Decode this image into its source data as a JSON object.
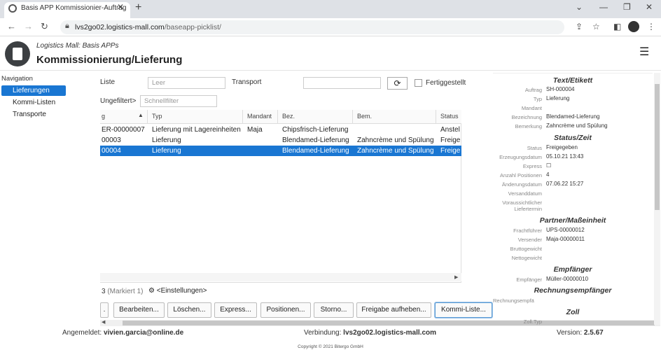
{
  "browser": {
    "tab_title": "Basis APP Kommissionier-Auftrag",
    "url_host": "lvs2go02.logistics-mall.com",
    "url_path": "/baseapp-picklist/"
  },
  "app": {
    "subtitle": "Logistics Mall: Basis APPs",
    "title": "Kommissionierung/Lieferung"
  },
  "nav": {
    "heading": "Navigation",
    "items": [
      {
        "label": "Lieferungen",
        "active": true
      },
      {
        "label": "Kommi-Listen",
        "active": false
      },
      {
        "label": "Transporte",
        "active": false
      }
    ]
  },
  "filters": {
    "liste_label": "Liste",
    "liste_placeholder": "Leer",
    "transport_label": "Transport",
    "fertig_label": "Fertiggestellt",
    "filter_label": "Ungefiltert>",
    "quick_placeholder": "Schnellfilter"
  },
  "table": {
    "headers": [
      "g",
      "Typ",
      "Mandant",
      "Bez.",
      "Bem.",
      "Status"
    ],
    "rows": [
      {
        "id": "ER-00000007",
        "typ": "Lieferung mit Lagereinheiten",
        "mandant": "Maja",
        "bez": "Chipsfrisch-Lieferung",
        "bem": "",
        "status": "Anstel",
        "selected": false
      },
      {
        "id": "00003",
        "typ": "Lieferung",
        "mandant": "",
        "bez": "Blendamed-Lieferung",
        "bem": "Zahncrème und Spülung",
        "status": "Freige",
        "selected": false
      },
      {
        "id": "00004",
        "typ": "Lieferung",
        "mandant": "",
        "bez": "Blendamed-Lieferung",
        "bem": "Zahncrème und Spülung",
        "status": "Freige",
        "selected": true
      }
    ],
    "count": "3",
    "marked": "(Markiert 1)",
    "settings": "<Einstellungen>"
  },
  "buttons": [
    "Bearbeiten...",
    "Löschen...",
    "Express...",
    "Positionen...",
    "Storno...",
    "Freigabe aufheben...",
    "Kommi-Liste..."
  ],
  "panel": {
    "text_title": "Text/Etikett",
    "text_fields": [
      {
        "k": "Auftrag",
        "v": "SH-000004"
      },
      {
        "k": "Typ",
        "v": "Lieferung"
      },
      {
        "k": "Mandant",
        "v": ""
      },
      {
        "k": "Bezeichnung",
        "v": "Blendamed-Lieferung"
      },
      {
        "k": "Bemerkung",
        "v": "Zahncrème und Spülung"
      }
    ],
    "status_title": "Status/Zeit",
    "status_fields": [
      {
        "k": "Status",
        "v": "Freigegeben"
      },
      {
        "k": "Erzeugungsdatum",
        "v": "05.10.21 13:43"
      },
      {
        "k": "Express",
        "v": "☐"
      },
      {
        "k": "Anzahl Positionen",
        "v": "4"
      },
      {
        "k": "Änderungsdatum",
        "v": "07.06.22 15:27"
      },
      {
        "k": "Versanddatum",
        "v": ""
      },
      {
        "k": "Voraussichtlicher Liefertermin",
        "v": ""
      }
    ],
    "partner_title": "Partner/Maßeinheit",
    "partner_fields": [
      {
        "k": "Frachtführer",
        "v": "UPS-00000012"
      },
      {
        "k": "Versender",
        "v": "Maja-00000011"
      },
      {
        "k": "Bruttogewicht",
        "v": ""
      },
      {
        "k": "Nettogewicht",
        "v": ""
      }
    ],
    "empf_title": "Empfänger",
    "empf_fields": [
      {
        "k": "Empfänger",
        "v": "Müller-00000010"
      }
    ],
    "rech_title": "Rechnungsempfänger",
    "rech_field": "Rechnungsempfä",
    "zoll_title": "Zoll",
    "zoll_field": "Zoll.Typ"
  },
  "footer": {
    "user_label": "Angemeldet:",
    "user": "vivien.garcia@online.de",
    "conn_label": "Verbindung:",
    "conn": "lvs2go02.logistics-mall.com",
    "version_label": "Version:",
    "version": "2.5.67",
    "copyright": "Copyright © 2021 Bitergo GmbH"
  }
}
